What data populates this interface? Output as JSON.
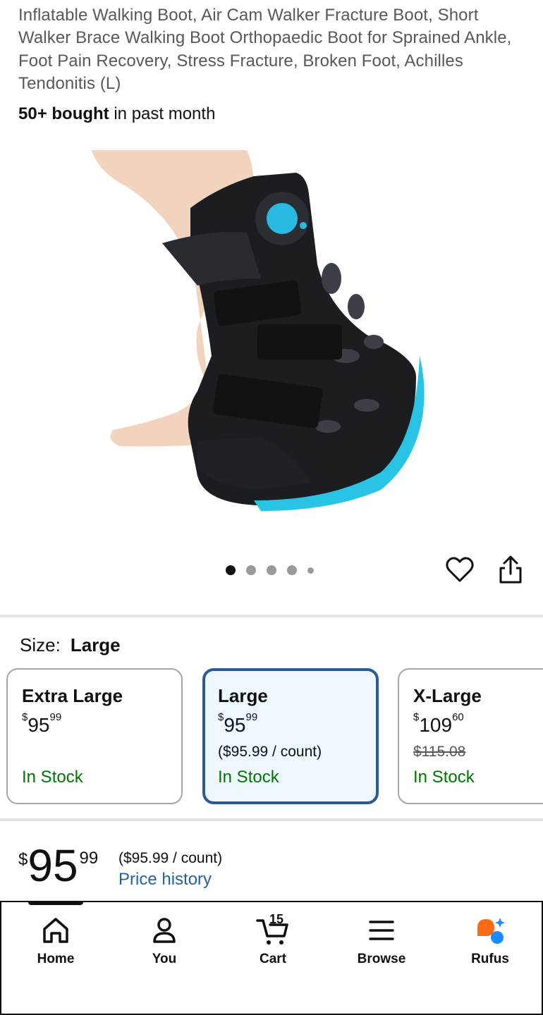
{
  "product": {
    "title": "Inflatable Walking Boot, Air Cam Walker Fracture Boot, Short Walker Brace Walking Boot Orthopaedic Boot for Sprained Ankle, Foot Pain Recovery, Stress Fracture, Broken Foot, Achilles Tendonitis (L)",
    "bought_strong": "50+ bought",
    "bought_rest": " in past month",
    "image_alt": "Black inflatable walking boot with blue sole worn on a foot",
    "image_index": 1,
    "image_count": 5
  },
  "actions": {
    "wishlist_icon": "heart-outline-icon",
    "share_icon": "share-icon"
  },
  "size": {
    "label": "Size:",
    "selected": "Large",
    "options": [
      {
        "name": "Extra Large",
        "currency": "$",
        "whole": "95",
        "fraction": "99",
        "per_unit": "",
        "list_price": "",
        "stock": "In Stock"
      },
      {
        "name": "Large",
        "currency": "$",
        "whole": "95",
        "fraction": "99",
        "per_unit": "($95.99 / count)",
        "list_price": "",
        "stock": "In Stock"
      },
      {
        "name": "X-Large",
        "currency": "$",
        "whole": "109",
        "fraction": "60",
        "per_unit": "",
        "list_price": "$115.08",
        "stock": "In Stock"
      }
    ]
  },
  "price": {
    "currency": "$",
    "whole": "95",
    "fraction": "99",
    "per_unit": "($95.99 / count)",
    "history_link": "Price history"
  },
  "nav": {
    "items": [
      {
        "label": "Home",
        "icon": "home-icon"
      },
      {
        "label": "You",
        "icon": "person-icon"
      },
      {
        "label": "Cart",
        "icon": "cart-icon",
        "count": "15"
      },
      {
        "label": "Browse",
        "icon": "menu-icon"
      },
      {
        "label": "Rufus",
        "icon": "rufus-icon"
      }
    ]
  },
  "colors": {
    "accent_link": "#2162a1",
    "in_stock": "#007600",
    "selected_border": "#2a5b94",
    "selected_bg": "#edf8ff",
    "rufus_orange": "#ff6a13",
    "rufus_blue": "#1a8cff"
  }
}
